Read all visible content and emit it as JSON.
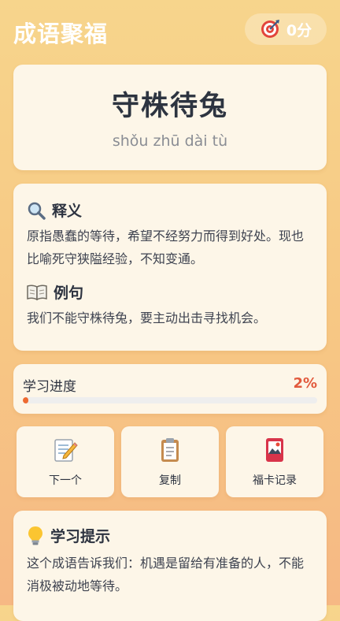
{
  "header": {
    "title": "成语聚福",
    "score_label": "0分",
    "score_icon": "target-icon"
  },
  "idiom": {
    "text": "守株待兔",
    "pinyin": "shǒu zhū dài tù"
  },
  "meaning": {
    "title": "释义",
    "title_icon": "magnifier-icon",
    "body": "原指愚蠢的等待，希望不经努力而得到好处。现也比喻死守狭隘经验，不知变通。"
  },
  "example": {
    "title": "例句",
    "title_icon": "open-book-icon",
    "body": "我们不能守株待兔，要主动出击寻找机会。"
  },
  "progress": {
    "label": "学习进度",
    "percent_label": "2%",
    "percent": 2,
    "color": "#ee6a31"
  },
  "actions": [
    {
      "label": "下一个",
      "icon": "memo-pencil-icon"
    },
    {
      "label": "复制",
      "icon": "clipboard-icon"
    },
    {
      "label": "福卡记录",
      "icon": "card-icon"
    }
  ],
  "tip": {
    "title": "学习提示",
    "title_icon": "lightbulb-icon",
    "body": "这个成语告诉我们：机遇是留给有准备的人，不能消极被动地等待。"
  },
  "colors": {
    "accent": "#e25a3d",
    "card": "#fdf6e8",
    "background_top": "#f7d58c",
    "background_bottom": "#f6b884"
  }
}
